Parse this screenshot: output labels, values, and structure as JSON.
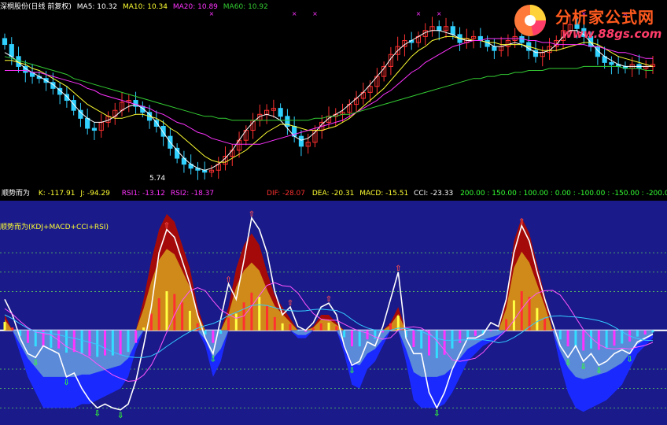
{
  "colors": {
    "up": "#ff3030",
    "down": "#30d0ff",
    "ma5": "#ffffff",
    "ma10": "#ffff33",
    "ma20": "#ff33ff",
    "ma60": "#33cc33",
    "panel_bg": "#1a1a8a",
    "zero_line": "#ffffff",
    "dash": "#5fd05f"
  },
  "header": {
    "stock": "深桐股份(日线 前复权)",
    "ma5_label": "MA5: 10.32",
    "ma10_label": "MA10: 10.34",
    "ma20_label": "MA20: 10.89",
    "ma60_label": "MA60: 10.92"
  },
  "indicator_header": {
    "name": "顺势而为",
    "k": "K: -117.91",
    "j": "J: -94.29",
    "rsi1": "RSI1: -13.12",
    "rsi2": "RSI2: -18.37",
    "dif": "DIF: -28.07",
    "dea": "DEA: -20.31",
    "macd": "MACD: -15.51",
    "cci": "CCI: -23.33",
    "levels": "200.00 : 150.00 : 100.00 : 0.00 : -100.00 : -150.00 : -200.00"
  },
  "panel_title": "顺势而为(KDJ+MACD+CCI+RSI)",
  "low_marker": "5.74",
  "logo": {
    "brand": "分析家公式网",
    "url": "www.88gs.com",
    "icon": "pie-chart-logo-icon"
  },
  "chart_data": [
    {
      "type": "candlestick",
      "title": "",
      "ylim": [
        5.2,
        13.8
      ],
      "close": [
        12.2,
        11.6,
        11.1,
        10.8,
        10.6,
        10.5,
        10.3,
        10.0,
        9.7,
        9.4,
        8.9,
        8.5,
        8.0,
        7.9,
        8.3,
        8.6,
        8.9,
        9.3,
        9.4,
        9.1,
        8.8,
        8.4,
        8.1,
        7.6,
        7.0,
        6.5,
        6.2,
        6.0,
        5.9,
        5.8,
        5.9,
        6.2,
        6.6,
        6.9,
        7.4,
        7.9,
        8.4,
        8.7,
        8.9,
        9.0,
        8.6,
        8.1,
        7.6,
        7.1,
        7.3,
        7.9,
        8.3,
        8.6,
        8.7,
        8.8,
        9.2,
        9.5,
        9.8,
        10.1,
        10.6,
        11.1,
        11.7,
        12.1,
        12.4,
        12.3,
        12.6,
        12.9,
        13.1,
        12.9,
        13.1,
        12.7,
        12.3,
        12.5,
        12.6,
        12.4,
        12.1,
        11.9,
        12.1,
        12.4,
        12.6,
        12.3,
        11.9,
        11.6,
        11.8,
        12.1,
        12.4,
        12.9,
        13.2,
        13.0,
        12.6,
        12.1,
        11.6,
        11.3,
        11.2,
        11.1,
        11.0,
        11.2,
        11.0,
        11.1,
        11.2
      ],
      "ma": {
        "MA5": [
          11.8,
          11.6,
          11.3,
          11.0,
          10.8,
          10.6,
          10.4,
          10.2,
          9.9,
          9.6,
          9.2,
          8.8,
          8.5,
          8.3,
          8.3,
          8.4,
          8.6,
          8.9,
          9.1,
          9.2,
          9.0,
          8.7,
          8.3,
          7.8,
          7.3,
          6.9,
          6.5,
          6.2,
          6.0,
          5.9,
          6.0,
          6.2,
          6.5,
          6.9,
          7.4,
          7.9,
          8.3,
          8.6,
          8.7,
          8.6,
          8.4,
          8.0,
          7.6,
          7.4,
          7.5,
          7.8,
          8.2,
          8.5,
          8.7,
          8.9,
          9.2,
          9.5,
          9.8,
          10.2,
          10.6,
          11.0,
          11.5,
          11.9,
          12.2,
          12.4,
          12.6,
          12.8,
          12.9,
          12.9,
          12.8,
          12.7,
          12.5,
          12.4,
          12.4,
          12.4,
          12.3,
          12.1,
          12.1,
          12.2,
          12.3,
          12.2,
          12.0,
          11.8,
          11.8,
          11.9,
          12.2,
          12.6,
          12.9,
          12.9,
          12.7,
          12.3,
          11.9,
          11.6,
          11.4,
          11.2,
          11.1,
          11.1,
          11.1,
          11.1,
          11.1
        ],
        "MA10": [
          11.4,
          11.4,
          11.3,
          11.2,
          11.0,
          10.9,
          10.7,
          10.5,
          10.3,
          10.1,
          9.8,
          9.5,
          9.2,
          9.0,
          8.8,
          8.6,
          8.5,
          8.5,
          8.6,
          8.7,
          8.7,
          8.6,
          8.5,
          8.3,
          8.0,
          7.8,
          7.5,
          7.2,
          6.9,
          6.6,
          6.4,
          6.3,
          6.3,
          6.5,
          6.7,
          6.9,
          7.2,
          7.5,
          7.8,
          8.0,
          8.2,
          8.2,
          8.1,
          8.0,
          7.9,
          7.9,
          7.9,
          8.0,
          8.1,
          8.3,
          8.5,
          8.8,
          9.1,
          9.4,
          9.7,
          10.0,
          10.4,
          10.8,
          11.2,
          11.6,
          11.9,
          12.1,
          12.4,
          12.5,
          12.6,
          12.6,
          12.5,
          12.5,
          12.4,
          12.4,
          12.3,
          12.3,
          12.2,
          12.2,
          12.2,
          12.2,
          12.1,
          12.0,
          11.9,
          11.9,
          11.9,
          12.0,
          12.1,
          12.2,
          12.3,
          12.3,
          12.2,
          12.0,
          11.8,
          11.6,
          11.5,
          11.4,
          11.3,
          11.2,
          11.1
        ],
        "MA20": [
          10.9,
          10.9,
          10.9,
          10.9,
          10.8,
          10.8,
          10.7,
          10.6,
          10.5,
          10.4,
          10.3,
          10.2,
          10.0,
          9.9,
          9.7,
          9.6,
          9.5,
          9.4,
          9.3,
          9.2,
          9.1,
          9.0,
          8.8,
          8.7,
          8.5,
          8.3,
          8.2,
          8.0,
          7.8,
          7.7,
          7.5,
          7.4,
          7.3,
          7.2,
          7.2,
          7.2,
          7.2,
          7.2,
          7.3,
          7.4,
          7.5,
          7.6,
          7.7,
          7.8,
          7.9,
          8.0,
          8.1,
          8.2,
          8.3,
          8.4,
          8.6,
          8.8,
          9.0,
          9.2,
          9.4,
          9.7,
          9.9,
          10.2,
          10.5,
          10.8,
          11.0,
          11.3,
          11.5,
          11.7,
          11.9,
          12.1,
          12.2,
          12.3,
          12.4,
          12.4,
          12.5,
          12.5,
          12.5,
          12.5,
          12.5,
          12.5,
          12.4,
          12.4,
          12.3,
          12.3,
          12.2,
          12.2,
          12.2,
          12.2,
          12.2,
          12.1,
          12.1,
          12.0,
          11.9,
          11.8,
          11.8,
          11.7,
          11.6,
          11.5,
          11.5
        ],
        "MA60": [
          11.6,
          11.5,
          11.4,
          11.3,
          11.2,
          11.1,
          11.0,
          10.9,
          10.8,
          10.7,
          10.5,
          10.4,
          10.3,
          10.2,
          10.1,
          10.0,
          9.9,
          9.8,
          9.7,
          9.6,
          9.5,
          9.4,
          9.3,
          9.2,
          9.1,
          9.0,
          8.9,
          8.8,
          8.7,
          8.6,
          8.6,
          8.5,
          8.5,
          8.4,
          8.4,
          8.4,
          8.4,
          8.4,
          8.4,
          8.4,
          8.4,
          8.4,
          8.4,
          8.4,
          8.4,
          8.5,
          8.5,
          8.6,
          8.6,
          8.7,
          8.7,
          8.8,
          8.9,
          9.0,
          9.1,
          9.2,
          9.3,
          9.4,
          9.5,
          9.6,
          9.7,
          9.8,
          9.9,
          10.0,
          10.1,
          10.2,
          10.3,
          10.4,
          10.5,
          10.5,
          10.6,
          10.6,
          10.7,
          10.7,
          10.8,
          10.8,
          10.9,
          10.9,
          10.9,
          11.0,
          11.0,
          11.0,
          11.0,
          11.0,
          11.1,
          11.1,
          11.1,
          11.1,
          11.1,
          11.1,
          11.0,
          11.0,
          11.0,
          10.9,
          10.9
        ]
      }
    },
    {
      "type": "area",
      "title": "顺势而为(KDJ+MACD+CCI+RSI)",
      "ylim": [
        -240,
        320
      ],
      "levels": [
        200,
        150,
        100,
        0,
        -100,
        -150,
        -200
      ],
      "series": [
        {
          "name": "K",
          "values": [
            80,
            40,
            -20,
            -60,
            -70,
            -40,
            -50,
            -60,
            -120,
            -110,
            -150,
            -180,
            -200,
            -190,
            -200,
            -205,
            -190,
            -130,
            -40,
            60,
            200,
            260,
            240,
            180,
            120,
            40,
            -20,
            -60,
            30,
            120,
            80,
            180,
            290,
            260,
            200,
            100,
            40,
            60,
            10,
            0,
            20,
            60,
            70,
            40,
            -40,
            -90,
            -80,
            -30,
            -40,
            10,
            80,
            150,
            -20,
            -60,
            -60,
            -160,
            -200,
            -160,
            -100,
            -60,
            -20,
            -20,
            -10,
            20,
            10,
            80,
            200,
            270,
            230,
            150,
            80,
            20,
            -40,
            -70,
            -40,
            -80,
            -60,
            -90,
            -80,
            -60,
            -50,
            -60,
            -30,
            -20,
            -10
          ]
        },
        {
          "name": "CCI",
          "values": [
            40,
            0,
            -60,
            -120,
            -160,
            -200,
            -200,
            -200,
            -200,
            -200,
            -190,
            -190,
            -180,
            -170,
            -160,
            -150,
            -120,
            -50,
            80,
            180,
            260,
            300,
            280,
            220,
            160,
            60,
            -40,
            -120,
            -80,
            60,
            160,
            220,
            250,
            220,
            150,
            90,
            60,
            30,
            -20,
            -20,
            10,
            40,
            40,
            20,
            -60,
            -140,
            -150,
            -100,
            -80,
            -40,
            20,
            60,
            -80,
            -180,
            -200,
            -200,
            -200,
            -190,
            -160,
            -120,
            -80,
            -60,
            -40,
            -30,
            -20,
            80,
            230,
            290,
            250,
            170,
            90,
            0,
            -90,
            -160,
            -200,
            -210,
            -200,
            -190,
            -180,
            -160,
            -140,
            -100,
            -60,
            -40,
            -20
          ]
        }
      ]
    }
  ]
}
